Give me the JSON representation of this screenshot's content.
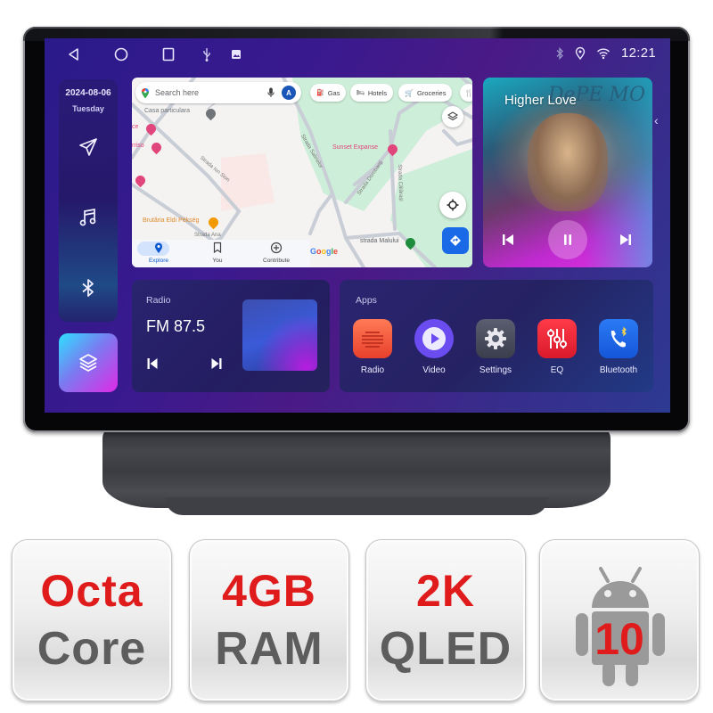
{
  "status_bar": {
    "nav_icons": [
      "back-icon",
      "home-icon",
      "recents-icon"
    ],
    "notification_icons": [
      "usb-icon",
      "image-icon"
    ],
    "system_icons": [
      "bluetooth-icon",
      "location-icon",
      "wifi-icon"
    ],
    "time": "12:21"
  },
  "dock": {
    "date": "2024-08-06",
    "day": "Tuesday",
    "items": [
      {
        "icon": "navigation-icon",
        "label": "Navigation"
      },
      {
        "icon": "music-icon",
        "label": "Music"
      },
      {
        "icon": "bluetooth-icon",
        "label": "Bluetooth"
      }
    ],
    "apps_button_icon": "layers-icon"
  },
  "map": {
    "search_placeholder": "Search here",
    "account_initial": "A",
    "chips": [
      "Gas",
      "Hotels",
      "Groceries"
    ],
    "places": [
      "Casa particulara",
      "Sunset Expanse",
      "Brutăria Eldi Pékség",
      "strada Malului",
      "rriso",
      "ce"
    ],
    "streets": [
      "Strada Ion Sion",
      "Strada Salinelor",
      "Strada Dorobanți",
      "Strada Călărași",
      "Strada Ana"
    ],
    "bottom_nav": [
      {
        "label": "Explore",
        "active": true
      },
      {
        "label": "You",
        "active": false
      },
      {
        "label": "Contribute",
        "active": false
      }
    ],
    "attribution": "Google"
  },
  "music": {
    "title": "Higher Love",
    "art_text": "DePE MO",
    "controls": [
      "previous",
      "pause",
      "next"
    ]
  },
  "radio": {
    "title": "Radio",
    "frequency": "FM 87.5"
  },
  "apps": {
    "title": "Apps",
    "items": [
      {
        "label": "Radio",
        "icon": "radio-app-icon",
        "color": "#f0553a"
      },
      {
        "label": "Video",
        "icon": "video-app-icon",
        "color": "#6a4cf0"
      },
      {
        "label": "Settings",
        "icon": "settings-app-icon",
        "color": "#4a4e5e"
      },
      {
        "label": "EQ",
        "icon": "eq-app-icon",
        "color": "#e8283a"
      },
      {
        "label": "Bluetooth",
        "icon": "bluetooth-phone-app-icon",
        "color": "#1a6ae8"
      }
    ]
  },
  "badges": [
    {
      "top": "Octa",
      "bottom": "Core"
    },
    {
      "top": "4GB",
      "bottom": "RAM"
    },
    {
      "top": "2K",
      "bottom": "QLED"
    },
    {
      "android_version": "10"
    }
  ],
  "colors": {
    "accent_red": "#e01b1b",
    "badge_gray_text": "#5d5d5d",
    "screen_purple": "#3a1a8e"
  }
}
